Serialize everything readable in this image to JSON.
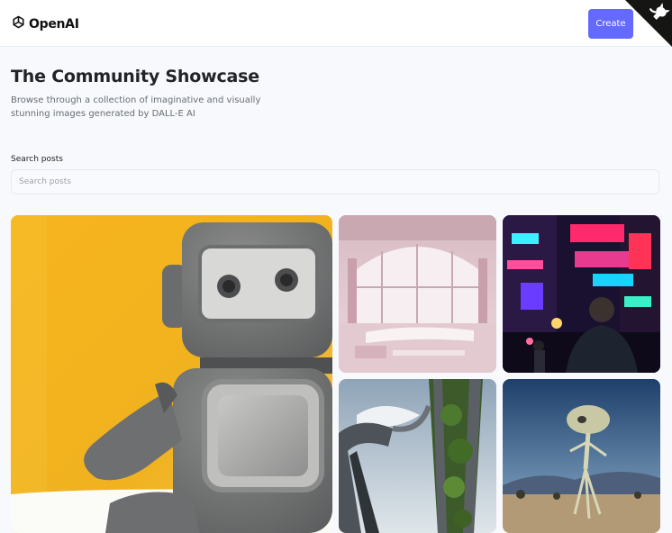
{
  "header": {
    "brand": "OpenAI",
    "create_label": "Create",
    "accent_color": "#6469ff"
  },
  "hero": {
    "title": "The Community Showcase",
    "subtitle": "Browse through a collection of imaginative and visually stunning images generated by DALL-E AI"
  },
  "search": {
    "label": "Search posts",
    "placeholder": "Search posts",
    "value": ""
  },
  "gallery": {
    "images": [
      {
        "subject": "clay robot on yellow background"
      },
      {
        "subject": "pink futuristic interior with arched windows"
      },
      {
        "subject": "man in neon-lit city street"
      },
      {
        "subject": "tower covered in vegetation"
      },
      {
        "subject": "alien creature in desert"
      }
    ]
  },
  "icons": [
    "openai-logo-icon",
    "github-corner-icon"
  ]
}
